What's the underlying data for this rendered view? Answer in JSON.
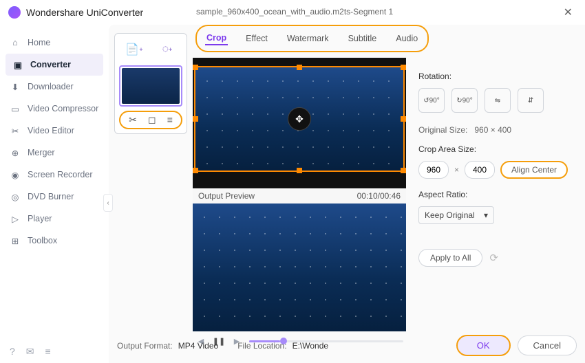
{
  "app": {
    "title": "Wondershare UniConverter"
  },
  "file": {
    "name": "sample_960x400_ocean_with_audio.m2ts-Segment 1"
  },
  "sidebar": {
    "items": [
      {
        "label": "Home",
        "icon": "home-icon"
      },
      {
        "label": "Converter",
        "icon": "converter-icon"
      },
      {
        "label": "Downloader",
        "icon": "downloader-icon"
      },
      {
        "label": "Video Compressor",
        "icon": "compressor-icon"
      },
      {
        "label": "Video Editor",
        "icon": "editor-icon"
      },
      {
        "label": "Merger",
        "icon": "merger-icon"
      },
      {
        "label": "Screen Recorder",
        "icon": "recorder-icon"
      },
      {
        "label": "DVD Burner",
        "icon": "burner-icon"
      },
      {
        "label": "Player",
        "icon": "player-icon"
      },
      {
        "label": "Toolbox",
        "icon": "toolbox-icon"
      }
    ]
  },
  "tabs": [
    {
      "label": "Crop"
    },
    {
      "label": "Effect"
    },
    {
      "label": "Watermark"
    },
    {
      "label": "Subtitle"
    },
    {
      "label": "Audio"
    }
  ],
  "preview": {
    "label": "Output Preview",
    "time": "00:10/00:46"
  },
  "rotation": {
    "label": "Rotation:"
  },
  "original": {
    "label": "Original Size:",
    "value": "960 × 400"
  },
  "cropArea": {
    "label": "Crop Area Size:",
    "w": "960",
    "h": "400",
    "alignCenter": "Align Center"
  },
  "aspect": {
    "label": "Aspect Ratio:",
    "selected": "Keep Original"
  },
  "applyAll": "Apply to All",
  "footer": {
    "outLabel": "Output Format:",
    "outVal": "MP4 Video",
    "locLabel": "File Location:",
    "locVal": "E:\\Wonde",
    "ok": "OK",
    "cancel": "Cancel"
  }
}
